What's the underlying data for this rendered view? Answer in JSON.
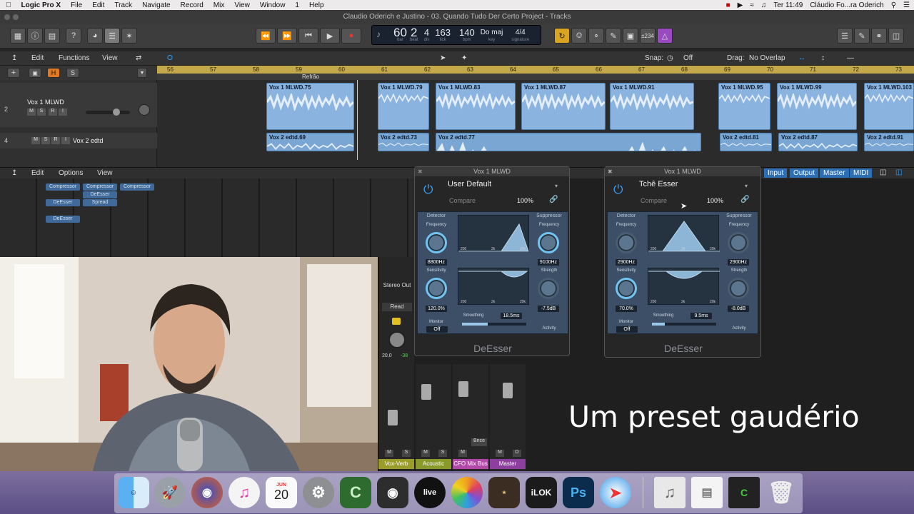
{
  "menubar": {
    "app": "Logic Pro X",
    "items": [
      "File",
      "Edit",
      "Track",
      "Navigate",
      "Record",
      "Mix",
      "View",
      "Window",
      "1",
      "Help"
    ],
    "clock": "Ter 11:49",
    "user": "Cláudio Fo...ra Oderich"
  },
  "window_title": "Claudio Oderich e Justino - 03. Quando Tudo Der Certo Project - Tracks",
  "lcd": {
    "bar": "60",
    "beat": "2",
    "div": "4",
    "tick": "163",
    "bpm": "140",
    "key": "Do maj",
    "signature": "4/4",
    "labels": {
      "bar": "bar",
      "beat": "beat",
      "div": "div",
      "tick": "tick",
      "bpm": "bpm",
      "key": "key",
      "signature": "signature"
    }
  },
  "toolbar": {
    "cpu_label": "±234"
  },
  "tracks_bar": {
    "edit": "Edit",
    "functions": "Functions",
    "view": "View",
    "snap_label": "Snap:",
    "snap_value": "Off",
    "drag_label": "Drag:",
    "drag_value": "No Overlap"
  },
  "ruler": {
    "bars": [
      "56",
      "57",
      "58",
      "59",
      "60",
      "61",
      "62",
      "63",
      "64",
      "65",
      "66",
      "67",
      "68",
      "69",
      "70",
      "71",
      "72",
      "73"
    ],
    "marker": "Refrão"
  },
  "tracks": [
    {
      "number": "2",
      "name": "Vox 1 MLWD",
      "buttons": [
        "M",
        "S",
        "R",
        "I"
      ]
    },
    {
      "number": "4",
      "name": "Vox 2 edtd",
      "buttons": [
        "M",
        "S",
        "R",
        "I"
      ]
    }
  ],
  "regions_v1": [
    "Vox 1 MLWD.75",
    "Vox 1 MLWD.79",
    "Vox 1 MLWD.83",
    "Vox 1 MLWD.87",
    "Vox 1 MLWD.91",
    "Vox 1 MLWD.95",
    "Vox 1 MLWD.99",
    "Vox 1 MLWD.103"
  ],
  "regions_v2": [
    "Vox 2 edtd.69",
    "Vox 2 edtd.73",
    "Vox 2 edtd.77",
    "Vox 2 edtd.81",
    "Vox 2 edtd.87",
    "Vox 2 edtd.91"
  ],
  "mixer_bar": {
    "edit": "Edit",
    "options": "Options",
    "view": "View",
    "tabs": [
      "Input",
      "Output",
      "Master",
      "MIDI"
    ]
  },
  "mixer_plugins": [
    {
      "col": 0,
      "items": [
        "Compressor",
        "DeEsser",
        "DeEsser"
      ]
    },
    {
      "col": 1,
      "items": [
        "Compressor",
        "DeEsser",
        "Spread"
      ]
    },
    {
      "col": 2,
      "items": [
        "Compressor"
      ]
    }
  ],
  "mixer_strips": {
    "stereo_out": "Stereo Out",
    "read": "Read",
    "gain": "20,0",
    "gain2": "-38",
    "bnce": "Bnce",
    "names": [
      "Vox-Verb",
      "Acoustic",
      "CFO Mix Bus",
      "Master"
    ],
    "buttons": [
      "M",
      "S",
      "M",
      "S",
      "M",
      "M",
      "D"
    ]
  },
  "plugins": [
    {
      "title": "Vox 1 MLWD",
      "preset": "User Default",
      "compare": "Compare",
      "percent": "100%",
      "detector": "Detector",
      "suppressor": "Suppressor",
      "det_freq_label": "Frequency",
      "det_freq": "8800Hz",
      "sens_label": "Sensitivity",
      "sens": "120.0%",
      "sup_freq_label": "Frequency",
      "sup_freq": "9100Hz",
      "strength_label": "Strength",
      "strength": "-7.5dB",
      "smoothing_label": "Smoothing",
      "smoothing": "18.5ms",
      "smoothing_level": 0.4,
      "monitor_label": "Monitor",
      "monitor": "Off",
      "activity_label": "Activity",
      "axis": [
        "200",
        "2k",
        "20k"
      ],
      "name": "DeEsser"
    },
    {
      "title": "Vox 1 MLWD",
      "preset": "Tchê Esser",
      "compare": "Compare",
      "percent": "100%",
      "detector": "Detector",
      "suppressor": "Suppressor",
      "det_freq_label": "Frequency",
      "det_freq": "2900Hz",
      "sens_label": "Sensitivity",
      "sens": "70.0%",
      "sup_freq_label": "Frequency",
      "sup_freq": "2900Hz",
      "strength_label": "Strength",
      "strength": "-8.0dB",
      "smoothing_label": "Smoothing",
      "smoothing": "9.5ms",
      "smoothing_level": 0.2,
      "monitor_label": "Monitor",
      "monitor": "Off",
      "activity_label": "Activity",
      "axis": [
        "200",
        "2k",
        "20k"
      ],
      "name": "DeEsser"
    }
  ],
  "overlay_caption": "Um preset gaudério",
  "dock": {
    "calendar_month": "JUN",
    "calendar_day": "20",
    "live_label": "live",
    "ilok_label": "iLOK",
    "ps_label": "Ps"
  },
  "colors": {
    "region_blue": "#8ab4df",
    "ruler_gold": "#c4a94a",
    "knob_ring": "#73c3f0",
    "strip_vox_verb": "#9a9d2a",
    "strip_acoustic": "#8a9a2a",
    "strip_cfo": "#b04aa6",
    "strip_master": "#8d3fa0"
  }
}
